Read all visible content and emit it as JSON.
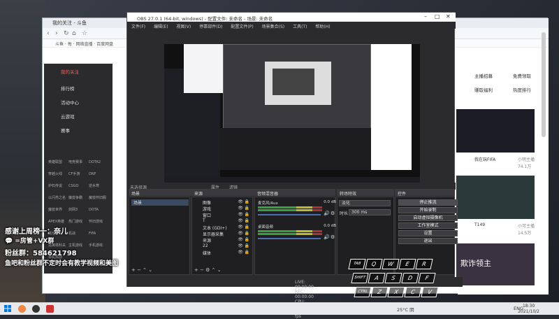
{
  "browser": {
    "tab": "我的关注 - 斗鱼",
    "bookmarks": "斗鱼 · 每 · 网络直播 · 百度网盘",
    "sidebar": [
      "我的关注",
      "排行榜",
      "活动中心",
      "云游戏",
      "赛事"
    ],
    "sidebar_grid": [
      "英雄联盟",
      "电竞赛事",
      "DOTA2",
      "穿越火线",
      "CF手游",
      "DNF",
      "炉石传说",
      "CSGO",
      "逆水寒",
      "以闪亮之名",
      "魔兽争霸",
      "魔兽怀旧服",
      "魔兽世界",
      "剑网3",
      "DOTA",
      "APEX英雄",
      "热门游戏",
      "怀旧游戏",
      "其他游戏",
      "机战",
      "FIFA",
      "逃离塔科夫",
      "主机游戏",
      "手机游戏",
      "单机热游"
    ],
    "right_buttons": [
      "主播招募",
      "免费领取",
      "赚取福利",
      "热度排行"
    ],
    "cards": [
      {
        "title": "我在玩FIFA",
        "meta": "小明主播",
        "count": "74.1万"
      },
      {
        "title": "T149",
        "meta": "小可主播",
        "count": "14.5万"
      },
      {
        "title": "欺诈领主",
        "meta": "",
        "count": ""
      }
    ]
  },
  "obs": {
    "title": "OBS 27.0.1 (64-bit, windows) - 配置文件: 未命名 - 场景: 未命名",
    "menu": [
      "文件(F)",
      "编辑(E)",
      "视图(V)",
      "停靠部件(D)",
      "配置文件(P)",
      "场景集合(S)",
      "工具(T)",
      "帮助(H)"
    ],
    "no_source_selected": "未选择源",
    "properties": "属性",
    "filters": "滤镜",
    "panels": {
      "scenes": "场景",
      "sources": "来源",
      "mixer": "音频混音器",
      "transitions": "转场特效",
      "controls": "控件"
    },
    "scene_item": "场景",
    "sources": [
      "图像",
      "游戏",
      "窗口",
      "T",
      "文本 (GDI+)",
      "显示器采集",
      "来源",
      "22",
      "媒体"
    ],
    "mixer": [
      {
        "name": "麦克风/Aux",
        "db": "0.0 dB"
      },
      {
        "name": "桌面音频",
        "db": "0.0 dB"
      }
    ],
    "transition_type": "淡化",
    "duration_label": "时长",
    "duration_value": "300 ms",
    "controls": [
      "停止推流",
      "开始录制",
      "启动虚拟摄像机",
      "工作室模式",
      "设置",
      "退出"
    ],
    "status": "LIVE: 00:00:00   REC: 00:00:00   CPU: 2.4%, 30.00 fps"
  },
  "overlay": {
    "line1": "感谢上周榜一：奈儿",
    "line2": "=房管+VX群",
    "line3": "粉丝群：584621798",
    "line4": "鱼吧和粉丝群不定时会有教学视频和美图"
  },
  "keyboard": {
    "rows": [
      [
        "TAB",
        "Q",
        "W",
        "E",
        "R"
      ],
      [
        "SHIFT",
        "A",
        "S",
        "D",
        "F"
      ],
      [
        "CTRL",
        "Z",
        "X",
        "C",
        "V"
      ]
    ]
  },
  "taskbar": {
    "weather": "25°C 阴",
    "lang": "ENG",
    "time": "18:30",
    "date": "2021/10/2"
  },
  "colors": {
    "accent": "#ff5b57",
    "obs_bg": "#2b2b2e",
    "selection": "#3b4a63"
  }
}
